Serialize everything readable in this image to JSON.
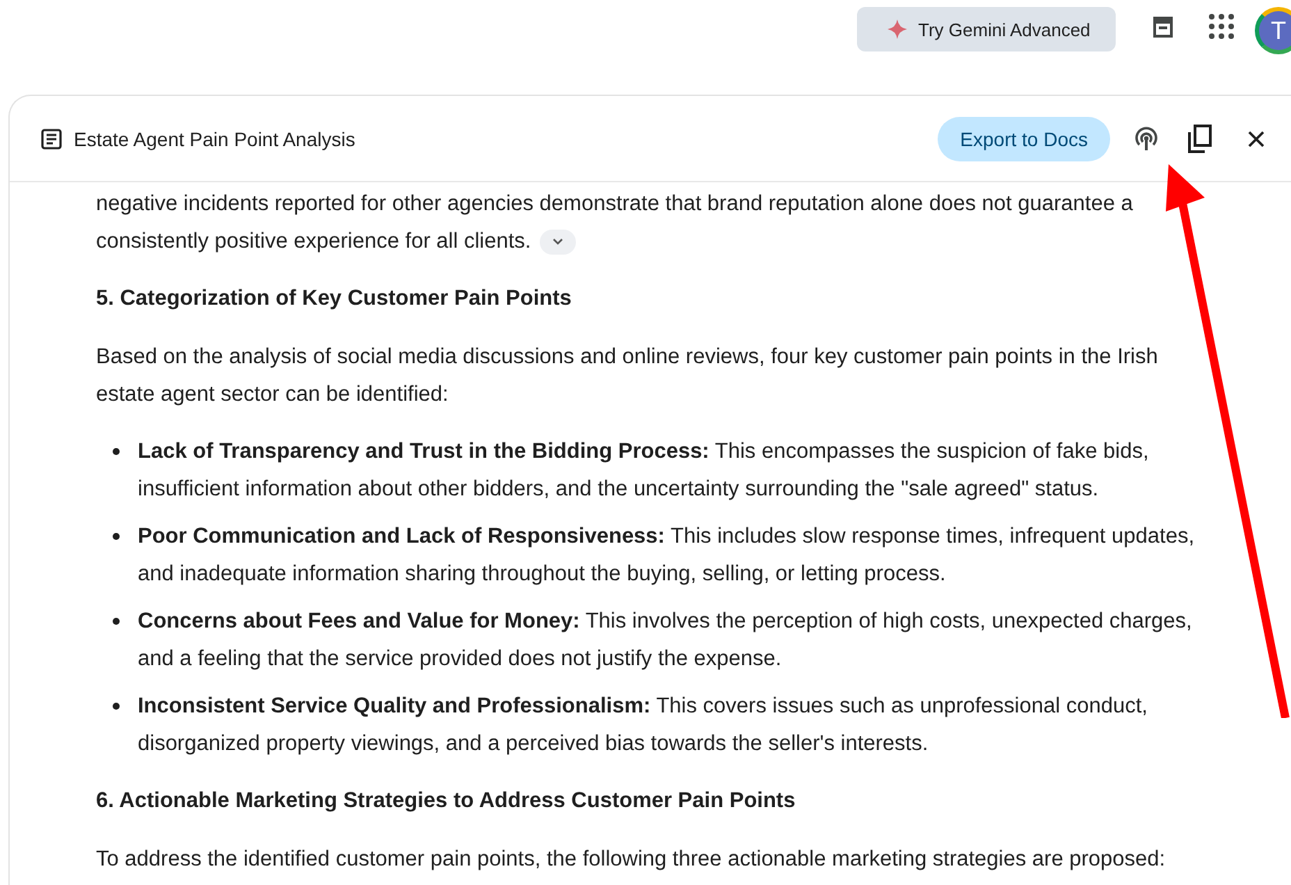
{
  "top_bar": {
    "upgrade_button": "Try Gemini Advanced",
    "avatar_letter": "T"
  },
  "panel": {
    "title": "Estate Agent Pain Point Analysis",
    "export_button": "Export to Docs"
  },
  "content": [
    {
      "kind": "paragraph",
      "text": "negative incidents reported for other agencies demonstrate that brand reputation alone does not guarantee a consistently positive experience for all clients.",
      "collapse_chip": true
    },
    {
      "kind": "heading",
      "text": "5. Categorization of Key Customer Pain Points"
    },
    {
      "kind": "paragraph",
      "text": "Based on the analysis of social media discussions and online reviews, four key customer pain points in the Irish estate agent sector can be identified:",
      "collapse_chip": false
    },
    {
      "kind": "bullets",
      "items": [
        "**Lack of Transparency and Trust in the Bidding Process:** This encompasses the suspicion of fake bids, insufficient information about other bidders, and the uncertainty surrounding the \"sale agreed\" status.",
        "**Poor Communication and Lack of Responsiveness:** This includes slow response times, infrequent updates, and inadequate information sharing throughout the buying, selling, or letting process.",
        "**Concerns about Fees and Value for Money:** This involves the perception of high costs, unexpected charges, and a feeling that the service provided does not justify the expense.",
        "**Inconsistent Service Quality and Professionalism:** This covers issues such as unprofessional conduct, disorganized property viewings, and a perceived bias towards the seller's interests."
      ]
    },
    {
      "kind": "heading",
      "text": "6. Actionable Marketing Strategies to Address Customer Pain Points"
    },
    {
      "kind": "paragraph",
      "text": "To address the identified customer pain points, the following three actionable marketing strategies are proposed:",
      "collapse_chip": false
    }
  ]
}
